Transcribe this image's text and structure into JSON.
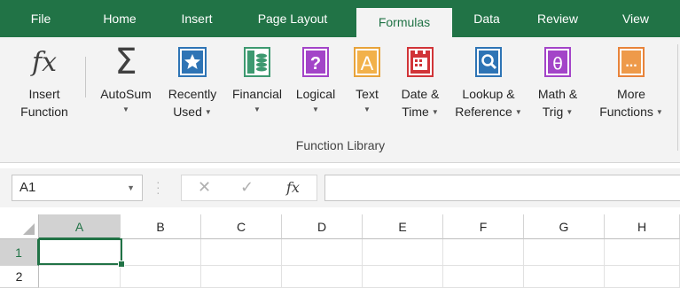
{
  "tabs": [
    "File",
    "Home",
    "Insert",
    "Page Layout",
    "Formulas",
    "Data",
    "Review",
    "View"
  ],
  "active_tab": "Formulas",
  "ribbon": {
    "insert_function": {
      "line1": "Insert",
      "line2": "Function",
      "icon": "fx"
    },
    "autosum": {
      "line1": "AutoSum",
      "icon": "Σ"
    },
    "recently_used": {
      "line1": "Recently",
      "line2": "Used"
    },
    "financial": {
      "line1": "Financial"
    },
    "logical": {
      "line1": "Logical",
      "icon": "?"
    },
    "text": {
      "line1": "Text",
      "icon": "A"
    },
    "date_time": {
      "line1": "Date &",
      "line2": "Time"
    },
    "lookup": {
      "line1": "Lookup &",
      "line2": "Reference"
    },
    "math": {
      "line1": "Math &",
      "line2": "Trig",
      "icon": "θ"
    },
    "more": {
      "line1": "More",
      "line2": "Functions",
      "icon": "..."
    },
    "group_label": "Function Library"
  },
  "formula_bar": {
    "name_box": "A1",
    "cancel_symbol": "✕",
    "enter_symbol": "✓",
    "fx_symbol": "fx",
    "formula": ""
  },
  "grid": {
    "columns": [
      "A",
      "B",
      "C",
      "D",
      "E",
      "F",
      "G",
      "H"
    ],
    "rows": [
      "1",
      "2"
    ],
    "selected_cell": "A1"
  },
  "colors": {
    "excel_green": "#217346",
    "ribbon_bg": "#f3f3f3",
    "icon_blue": "#2e74b5",
    "icon_purple": "#a344c8",
    "icon_orange": "#e8833a",
    "icon_teal": "#3d9970",
    "icon_red": "#d13438"
  }
}
